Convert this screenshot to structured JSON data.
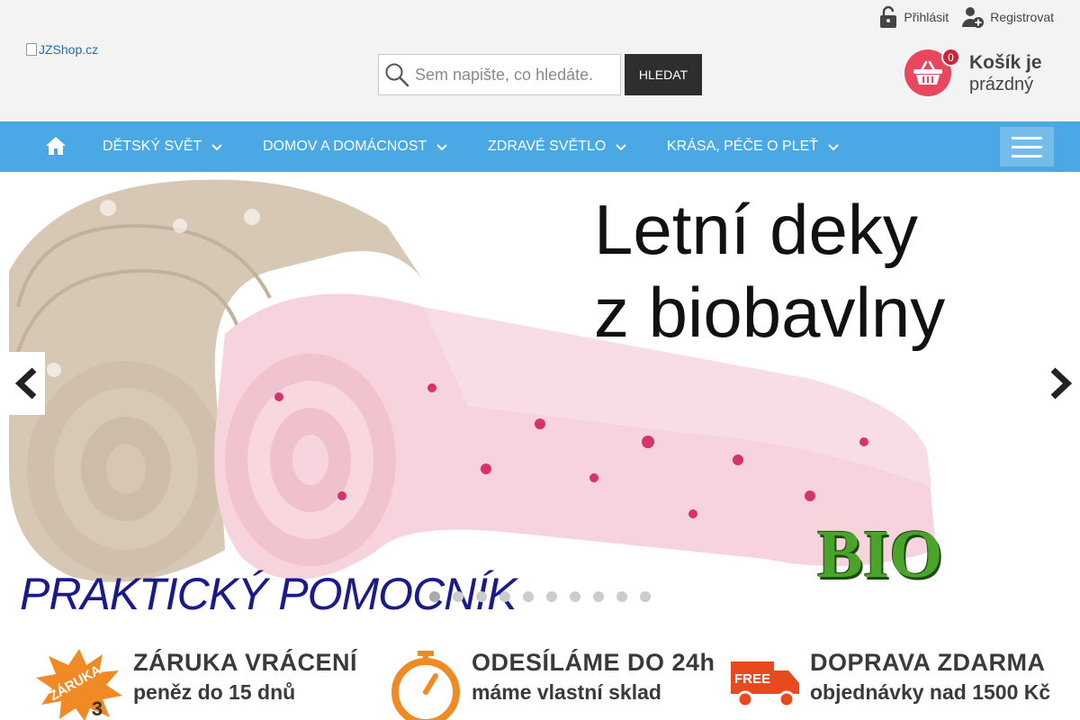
{
  "header": {
    "logo_alt": "JZShop.cz",
    "login_label": "Přihlásit",
    "register_label": "Registrovat",
    "search": {
      "placeholder": "Sem napište, co hledáte.",
      "button_label": "HLEDAT"
    },
    "cart": {
      "count": "0",
      "title": "Košík je",
      "subtitle": "prázdný"
    }
  },
  "nav": {
    "items": [
      {
        "label": "DĚTSKÝ SVĚT"
      },
      {
        "label": "DOMOV A DOMÁCNOST"
      },
      {
        "label": "ZDRAVÉ SVĚTLO"
      },
      {
        "label": "KRÁSA, PÉČE O PLEŤ"
      }
    ]
  },
  "banner": {
    "title_line1": "Letní deky",
    "title_line2": "z biobavlny",
    "bottom_text": "PRAKTICKÝ POMOCNÍK",
    "badge_text": "BIO",
    "slide_count": 10,
    "active_slide": 1
  },
  "features": [
    {
      "line1": "ZÁRUKA VRÁCENÍ",
      "line2": "peněz do 15 dnů",
      "badge": "ZÁRUKA",
      "badge_number": "3"
    },
    {
      "line1": "ODESÍLÁME DO 24h",
      "line2": "máme vlastní sklad"
    },
    {
      "line1": "DOPRAVA ZDARMA",
      "line2": "objednávky nad 1500 Kč",
      "badge": "FREE"
    }
  ],
  "colors": {
    "nav_bg": "#4aa8e4",
    "cart_accent": "#e8475f",
    "search_button": "#2e2e2e",
    "feature_accent": "#f08a24"
  }
}
